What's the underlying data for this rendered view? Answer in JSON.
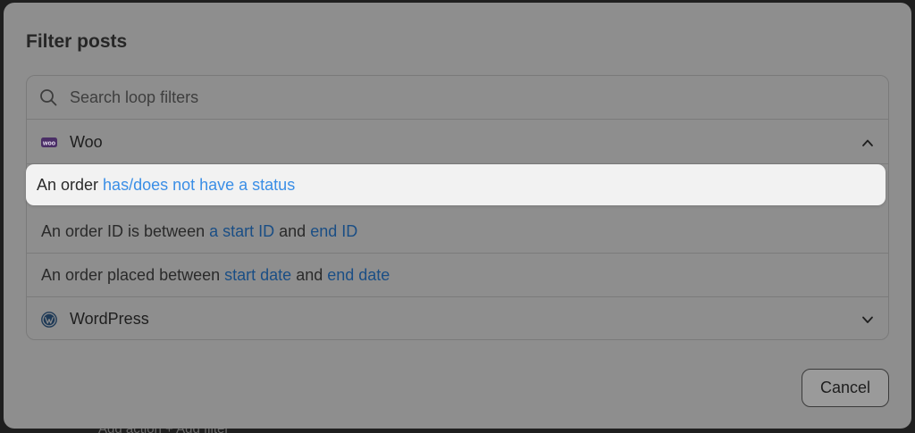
{
  "backdrop": {
    "text": "Add action  + Add filter"
  },
  "modal": {
    "title": "Filter posts",
    "search": {
      "placeholder": "Search loop filters",
      "value": ""
    },
    "groups": {
      "woo": {
        "label": "Woo",
        "icon": "woo-icon",
        "expanded": true,
        "options": [
          {
            "prefix": "An order ",
            "parts": [
              {
                "link": "has/does not have a status"
              }
            ]
          },
          {
            "prefix": "An order ID is between ",
            "link1": "a start ID",
            "mid": " and ",
            "link2": "end ID"
          },
          {
            "prefix": "An order placed between ",
            "link1": "start date",
            "mid": " and ",
            "link2": "end date"
          }
        ]
      },
      "wordpress": {
        "label": "WordPress",
        "icon": "wordpress-icon",
        "expanded": false
      }
    },
    "cancel_label": "Cancel"
  },
  "colors": {
    "overlay": "#8e8e8e",
    "highlight_bg": "#f2f2f2",
    "link_active": "#3a8ee6",
    "link_dim": "#1a4e85",
    "woo_brand": "#7f54b3"
  }
}
